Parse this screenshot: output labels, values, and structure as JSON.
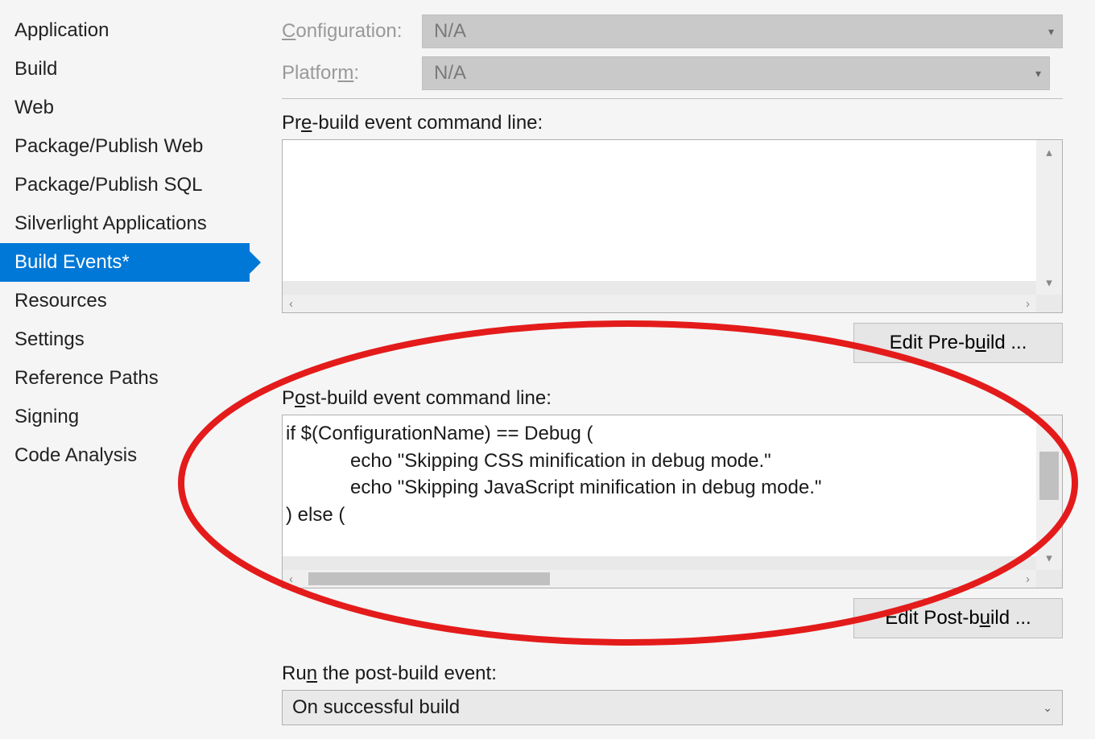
{
  "sidebar": {
    "items": [
      {
        "label": "Application"
      },
      {
        "label": "Build"
      },
      {
        "label": "Web"
      },
      {
        "label": "Package/Publish Web"
      },
      {
        "label": "Package/Publish SQL"
      },
      {
        "label": "Silverlight Applications"
      },
      {
        "label": "Build Events*"
      },
      {
        "label": "Resources"
      },
      {
        "label": "Settings"
      },
      {
        "label": "Reference Paths"
      },
      {
        "label": "Signing"
      },
      {
        "label": "Code Analysis"
      }
    ],
    "selected_index": 6
  },
  "top": {
    "configuration_label_pre": "C",
    "configuration_label_post": "onfiguration:",
    "configuration_value": "N/A",
    "platform_label_pre": "Platfor",
    "platform_label_post": ":",
    "platform_label_underline": "m",
    "platform_value": "N/A"
  },
  "prebuild": {
    "label_pre": "Pr",
    "label_u": "e",
    "label_post": "-build event command line:",
    "content": "",
    "button_pre": "Edit Pre-b",
    "button_u": "u",
    "button_post": "ild ..."
  },
  "postbuild": {
    "label_pre": "P",
    "label_u": "o",
    "label_post": "st-build event command line:",
    "content": "if $(ConfigurationName) == Debug (\n            echo \"Skipping CSS minification in debug mode.\"\n            echo \"Skipping JavaScript minification in debug mode.\"\n) else (",
    "button_pre": "Edit Post-b",
    "button_u": "u",
    "button_post": "ild ..."
  },
  "runevent": {
    "label_pre": "Ru",
    "label_u": "n",
    "label_post": " the post-build event:",
    "value": "On successful build"
  }
}
